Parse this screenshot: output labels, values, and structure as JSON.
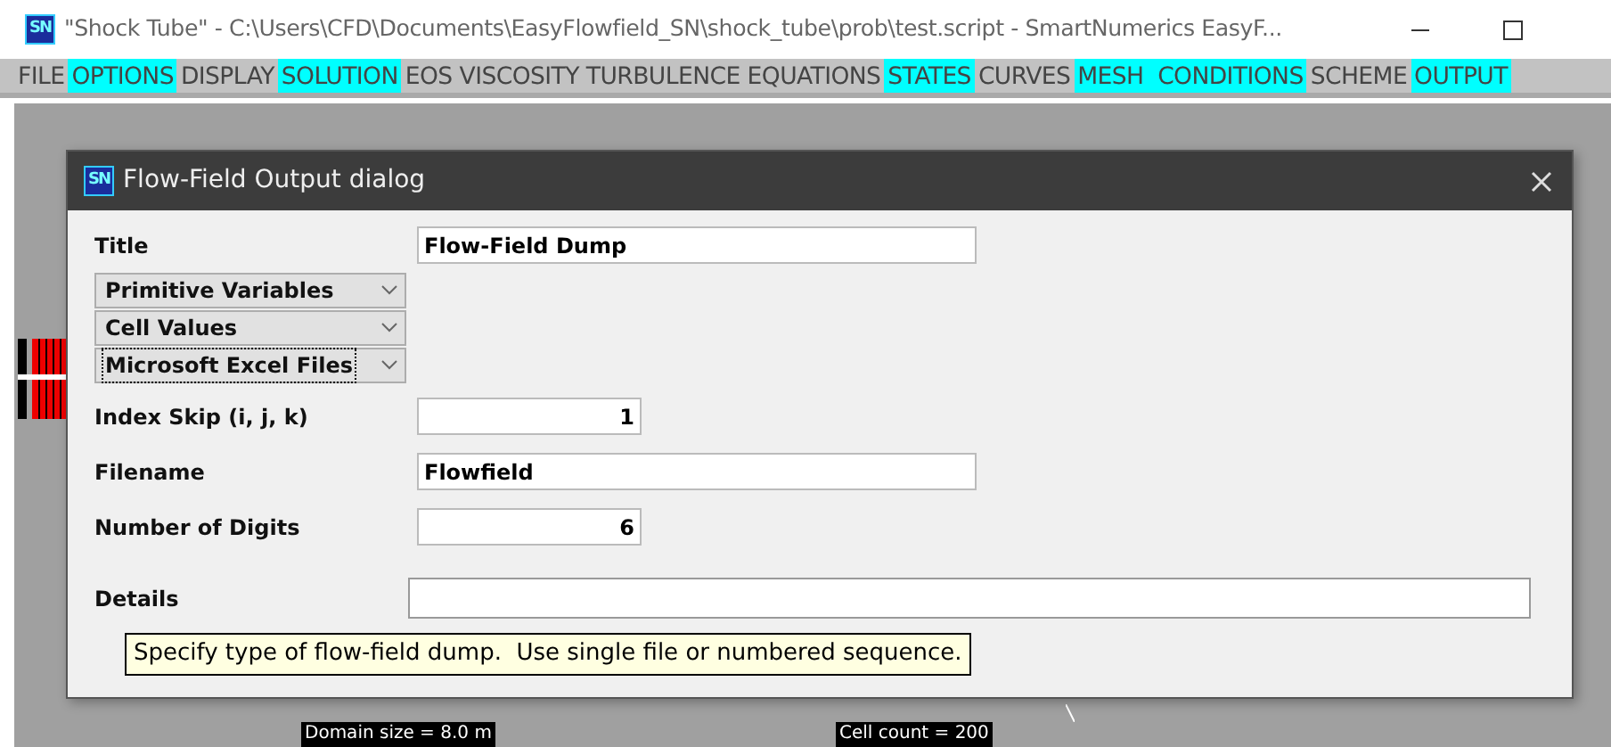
{
  "window": {
    "title": "\"Shock Tube\" - C:\\Users\\CFD\\Documents\\EasyFlowfield_SN\\shock_tube\\prob\\test.script - SmartNumerics EasyF...",
    "icon_text": "SN"
  },
  "menu": [
    {
      "label": "FILE",
      "highlighted": false
    },
    {
      "label": "OPTIONS",
      "highlighted": true
    },
    {
      "label": "DISPLAY",
      "highlighted": false
    },
    {
      "label": "SOLUTION",
      "highlighted": true
    },
    {
      "label": "EOS",
      "highlighted": false
    },
    {
      "label": "VISCOSITY",
      "highlighted": false
    },
    {
      "label": "TURBULENCE",
      "highlighted": false
    },
    {
      "label": "EQUATIONS",
      "highlighted": false
    },
    {
      "label": "STATES",
      "highlighted": true
    },
    {
      "label": "CURVES",
      "highlighted": false
    },
    {
      "label": "MESH  CONDITIONS",
      "highlighted": true
    },
    {
      "label": "SCHEME",
      "highlighted": false
    },
    {
      "label": "OUTPUT",
      "highlighted": true
    }
  ],
  "dialog": {
    "title": "Flow-Field Output dialog",
    "icon_text": "SN",
    "fields": [
      {
        "kind": "text",
        "label": "Title",
        "value": "Flow-Field Dump"
      },
      {
        "kind": "select",
        "value": "Primitive Variables",
        "focused": false
      },
      {
        "kind": "select",
        "value": "Cell Values",
        "focused": false
      },
      {
        "kind": "select",
        "value": "Microsoft Excel Files",
        "focused": true
      },
      {
        "kind": "number",
        "label": "Index Skip (i, j, k)",
        "value": "1"
      },
      {
        "kind": "text",
        "label": "Filename",
        "value": "Flowfield"
      },
      {
        "kind": "number",
        "label": "Number of Digits",
        "value": "6"
      },
      {
        "kind": "wide",
        "label": "Details"
      }
    ],
    "tooltip": "Specify type of flow-field dump.  Use single file or numbered sequence."
  },
  "canvas_labels": [
    "Domain size = 8.0 m",
    "Cell count = 200"
  ]
}
